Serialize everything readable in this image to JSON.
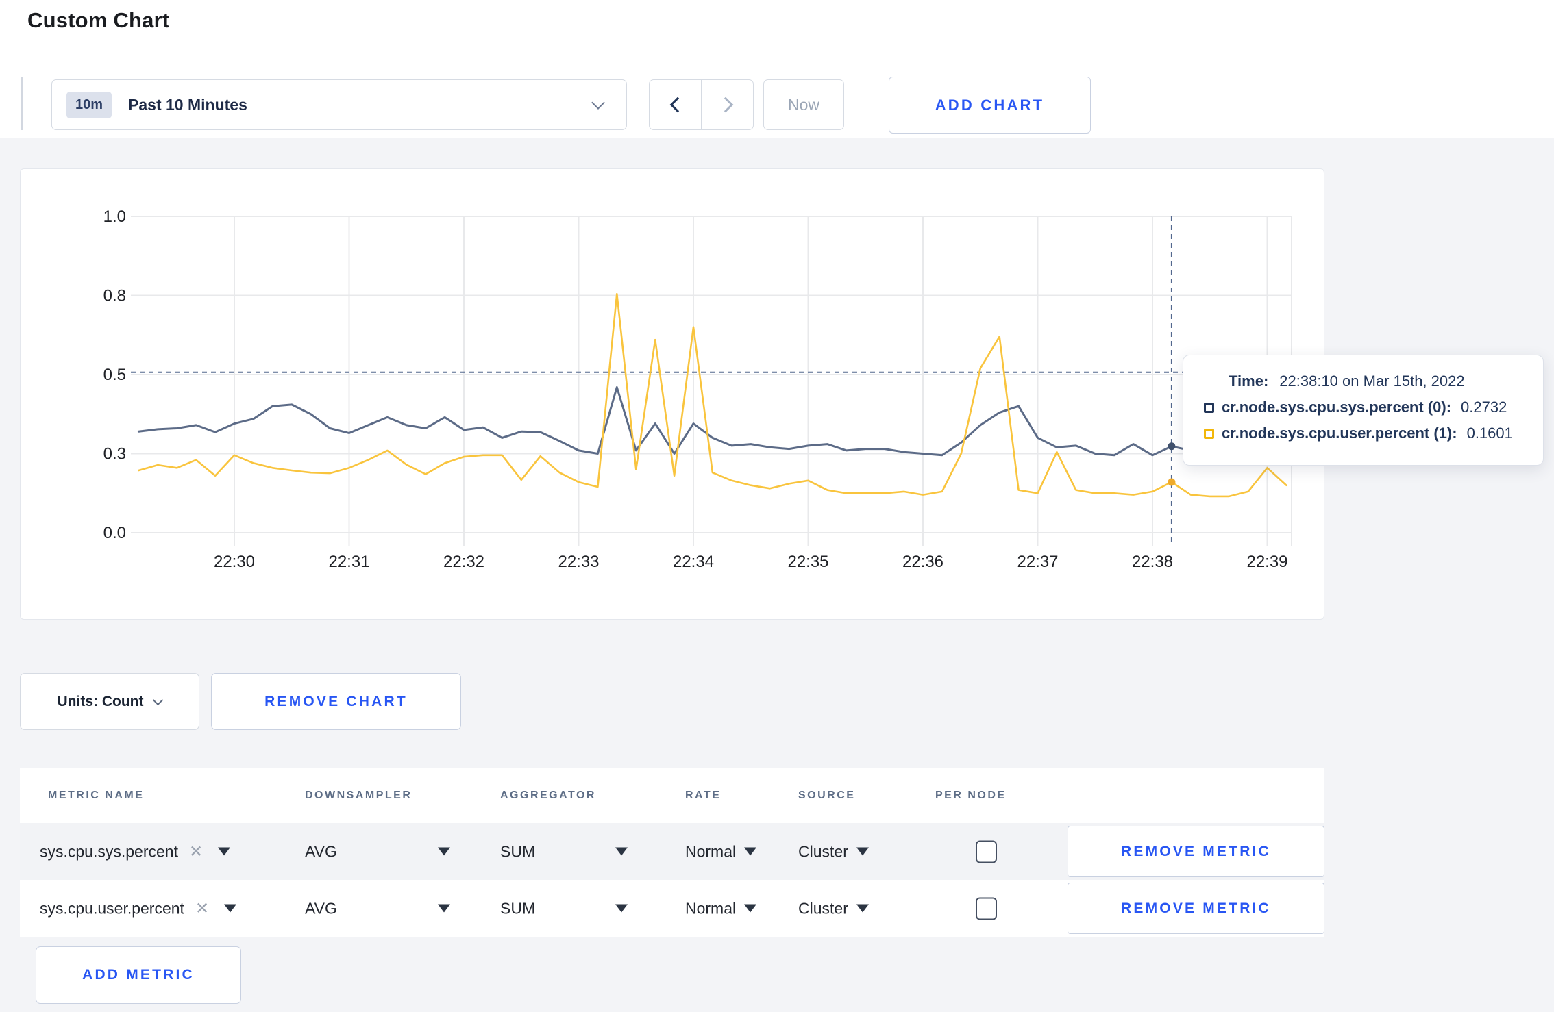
{
  "page": {
    "title": "Custom Chart",
    "background": "#f3f4f7",
    "accent_blue": "#2856f3"
  },
  "toolbar": {
    "time_selector": {
      "badge": "10m",
      "label": "Past 10 Minutes"
    },
    "now_label": "Now",
    "add_chart_label": "ADD CHART"
  },
  "chart_controls": {
    "units_label": "Units: Count",
    "remove_chart_label": "REMOVE CHART"
  },
  "tooltip": {
    "time_label": "Time:",
    "time_value": "22:38:10 on Mar 15th, 2022",
    "series": [
      {
        "name": "cr.node.sys.cpu.sys.percent (0):",
        "value": "0.2732",
        "color": "#223659"
      },
      {
        "name": "cr.node.sys.cpu.user.percent (1):",
        "value": "0.1601",
        "color": "#f2b70a"
      }
    ]
  },
  "chart_data": {
    "type": "line",
    "x_start": "22:29:10",
    "x_step_sec": 10,
    "x_ticks": [
      "22:30",
      "22:31",
      "22:32",
      "22:33",
      "22:34",
      "22:35",
      "22:36",
      "22:37",
      "22:38",
      "22:39"
    ],
    "y_ticks": [
      {
        "value": 1.0,
        "label": "1.0"
      },
      {
        "value": 0.75,
        "label": "0.8"
      },
      {
        "value": 0.5,
        "label": "0.5"
      },
      {
        "value": 0.25,
        "label": "0.3"
      },
      {
        "value": 0.0,
        "label": "0.0"
      }
    ],
    "ylim": [
      0,
      1
    ],
    "grid": true,
    "legend_position": "tooltip",
    "crosshair": {
      "time": "22:38:10",
      "index": 54,
      "hline_value": 0.507
    },
    "series": [
      {
        "name": "cr.node.sys.cpu.sys.percent",
        "color": "#5c6b87",
        "dot_color": "#40516d",
        "values": [
          0.32,
          0.327,
          0.33,
          0.34,
          0.318,
          0.345,
          0.36,
          0.4,
          0.405,
          0.375,
          0.33,
          0.315,
          0.34,
          0.365,
          0.34,
          0.33,
          0.365,
          0.325,
          0.333,
          0.3,
          0.32,
          0.318,
          0.29,
          0.26,
          0.25,
          0.46,
          0.26,
          0.345,
          0.25,
          0.345,
          0.3,
          0.275,
          0.28,
          0.27,
          0.265,
          0.275,
          0.28,
          0.26,
          0.265,
          0.265,
          0.255,
          0.25,
          0.245,
          0.285,
          0.34,
          0.38,
          0.4,
          0.3,
          0.27,
          0.275,
          0.25,
          0.245,
          0.28,
          0.245,
          0.2732,
          0.26,
          0.255,
          0.26,
          0.265,
          0.27,
          0.265
        ]
      },
      {
        "name": "cr.node.sys.cpu.user.percent",
        "color": "#f9c43d",
        "dot_color": "#efaa2a",
        "values": [
          0.197,
          0.214,
          0.205,
          0.23,
          0.18,
          0.245,
          0.22,
          0.205,
          0.197,
          0.19,
          0.188,
          0.205,
          0.23,
          0.26,
          0.215,
          0.185,
          0.22,
          0.24,
          0.245,
          0.245,
          0.167,
          0.242,
          0.19,
          0.16,
          0.145,
          0.755,
          0.2,
          0.61,
          0.18,
          0.65,
          0.19,
          0.165,
          0.15,
          0.14,
          0.155,
          0.165,
          0.135,
          0.125,
          0.125,
          0.125,
          0.13,
          0.12,
          0.13,
          0.25,
          0.52,
          0.62,
          0.135,
          0.125,
          0.255,
          0.135,
          0.125,
          0.125,
          0.12,
          0.13,
          0.1601,
          0.12,
          0.115,
          0.115,
          0.13,
          0.205,
          0.15
        ]
      }
    ]
  },
  "metrics_table": {
    "headers": [
      "METRIC NAME",
      "DOWNSAMPLER",
      "AGGREGATOR",
      "RATE",
      "SOURCE",
      "PER NODE"
    ],
    "rows": [
      {
        "metric": "sys.cpu.sys.percent",
        "downsampler": "AVG",
        "aggregator": "SUM",
        "rate": "Normal",
        "source": "Cluster",
        "per_node_checked": false,
        "remove_label": "REMOVE METRIC"
      },
      {
        "metric": "sys.cpu.user.percent",
        "downsampler": "AVG",
        "aggregator": "SUM",
        "rate": "Normal",
        "source": "Cluster",
        "per_node_checked": false,
        "remove_label": "REMOVE METRIC"
      }
    ],
    "add_metric_label": "ADD METRIC"
  }
}
